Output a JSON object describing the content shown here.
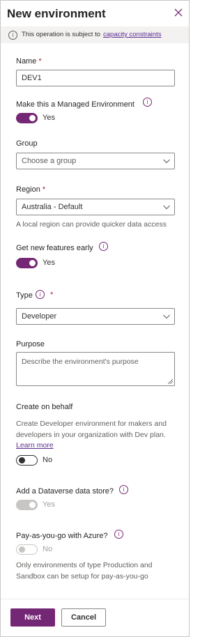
{
  "header": {
    "title": "New environment",
    "close_icon": "close-icon"
  },
  "notice": {
    "text": "This operation is subject to",
    "link": "capacity constraints",
    "icon": "info-icon"
  },
  "form": {
    "name": {
      "label": "Name",
      "required_mark": "*",
      "value": "DEV1"
    },
    "managed": {
      "label": "Make this a Managed Environment",
      "state": "Yes",
      "on": true
    },
    "group": {
      "label": "Group",
      "placeholder": "Choose a group"
    },
    "region": {
      "label": "Region",
      "required_mark": "*",
      "value": "Australia - Default",
      "helper": "A local region can provide quicker data access"
    },
    "early_features": {
      "label": "Get new features early",
      "state": "Yes",
      "on": true
    },
    "type": {
      "label": "Type",
      "required_mark": "*",
      "value": "Developer"
    },
    "purpose": {
      "label": "Purpose",
      "placeholder": "Describe the environment's purpose"
    },
    "create_on_behalf": {
      "label": "Create on behalf",
      "description": "Create Developer environment for makers and developers in your organization with Dev plan.",
      "learn_more": "Learn more",
      "state": "No",
      "on": false
    },
    "dataverse": {
      "label": "Add a Dataverse data store?",
      "state": "Yes",
      "on": true,
      "disabled": true
    },
    "payg": {
      "label": "Pay-as-you-go with Azure?",
      "state": "No",
      "on": false,
      "disabled": true,
      "helper": "Only environments of type Production and Sandbox can be setup for pay-as-you-go"
    }
  },
  "footer": {
    "next": "Next",
    "cancel": "Cancel"
  },
  "colors": {
    "accent": "#742774",
    "required": "#a4262c",
    "link": "#5c2e91"
  }
}
